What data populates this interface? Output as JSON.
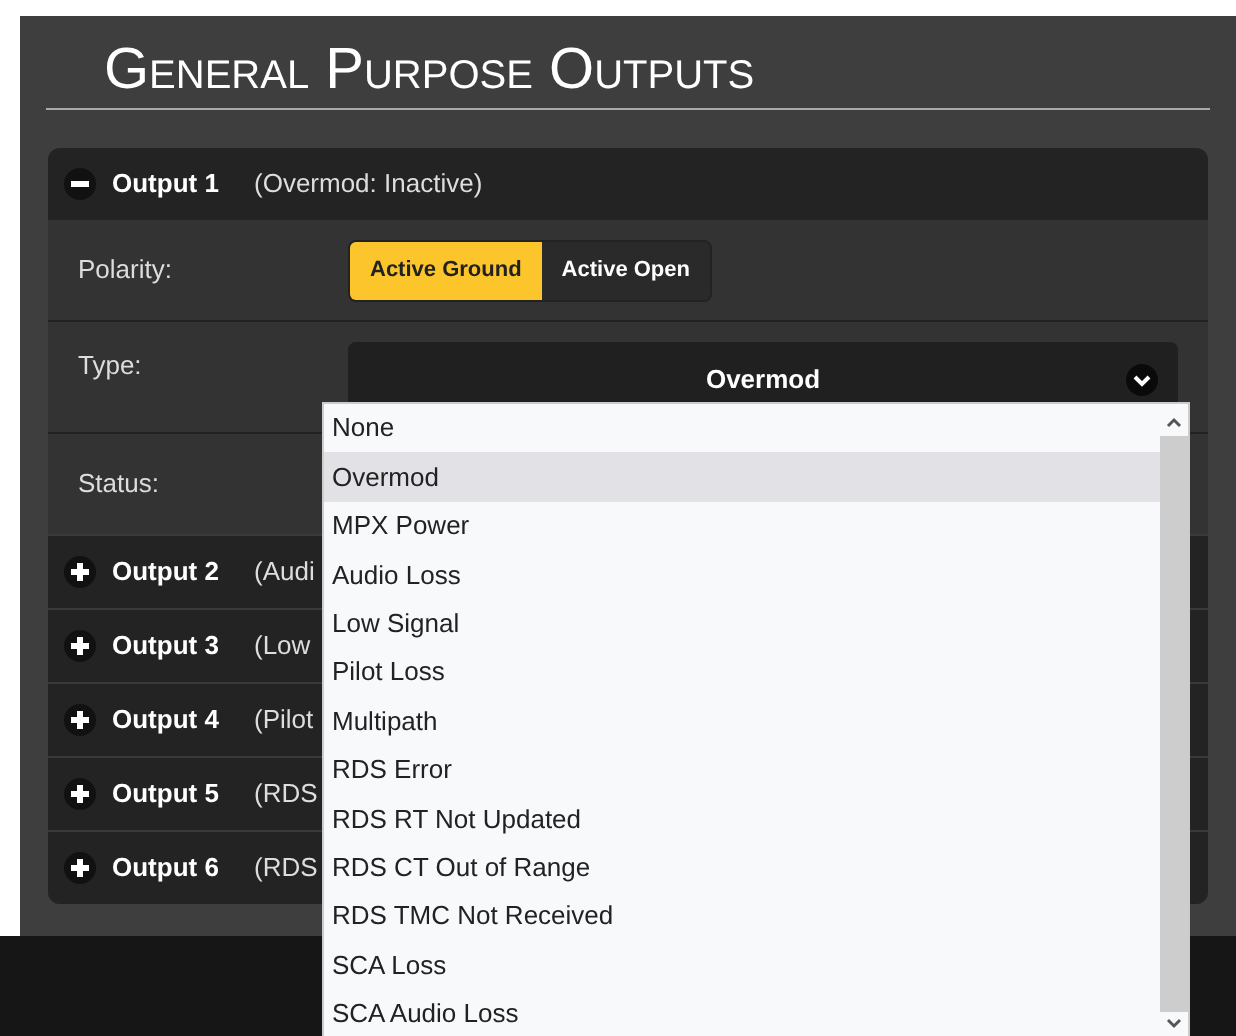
{
  "title": "General Purpose Outputs",
  "outputs": [
    {
      "label": "Output 1",
      "summary": "(Overmod: Inactive)",
      "expanded": true,
      "fields": [
        {
          "kind": "toggle",
          "label": "Polarity:",
          "options": [
            {
              "label": "Active Ground",
              "selected": true
            },
            {
              "label": "Active Open",
              "selected": false
            }
          ]
        },
        {
          "kind": "select",
          "label": "Type:",
          "value": "Overmod"
        },
        {
          "kind": "status",
          "label": "Status:"
        }
      ]
    },
    {
      "label": "Output 2",
      "summary": "(Audi",
      "expanded": false
    },
    {
      "label": "Output 3",
      "summary": "(Low",
      "expanded": false
    },
    {
      "label": "Output 4",
      "summary": "(Pilot",
      "expanded": false
    },
    {
      "label": "Output 5",
      "summary": "(RDS",
      "expanded": false
    },
    {
      "label": "Output 6",
      "summary": "(RDS",
      "expanded": false
    }
  ],
  "dropdown": {
    "options": [
      {
        "label": "None",
        "selected": false
      },
      {
        "label": "Overmod",
        "selected": true
      },
      {
        "label": "MPX Power",
        "selected": false
      },
      {
        "label": "Audio Loss",
        "selected": false
      },
      {
        "label": "Low Signal",
        "selected": false
      },
      {
        "label": "Pilot Loss",
        "selected": false
      },
      {
        "label": "Multipath",
        "selected": false
      },
      {
        "label": "RDS Error",
        "selected": false
      },
      {
        "label": "RDS RT Not Updated",
        "selected": false
      },
      {
        "label": "RDS CT Out of Range",
        "selected": false
      },
      {
        "label": "RDS TMC Not Received",
        "selected": false
      },
      {
        "label": "SCA Loss",
        "selected": false
      },
      {
        "label": "SCA Audio Loss",
        "selected": false
      }
    ]
  }
}
